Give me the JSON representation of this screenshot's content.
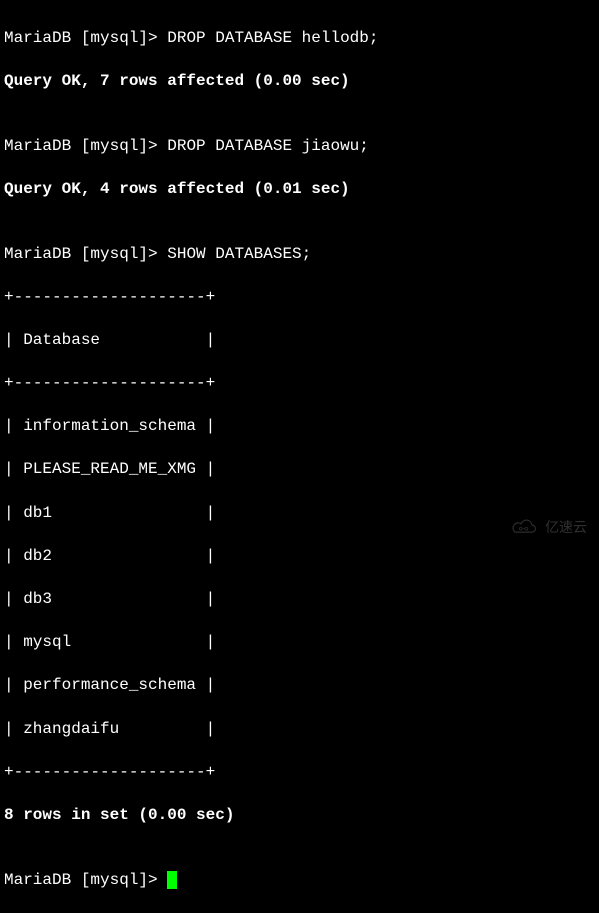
{
  "lines": {
    "l1_prompt": "MariaDB [mysql]> ",
    "l1_cmd": "DROP DATABASE hellodb;",
    "l2": "Query OK, 7 rows affected (0.00 sec)",
    "l3": "",
    "l4_prompt": "MariaDB [mysql]> ",
    "l4_cmd": "DROP DATABASE jiaowu;",
    "l5": "Query OK, 4 rows affected (0.01 sec)",
    "l6": "",
    "l7_prompt": "MariaDB [mysql]> ",
    "l7_cmd": "SHOW DATABASES;",
    "l8": "+--------------------+",
    "l9": "| Database           |",
    "l10": "+--------------------+",
    "l11": "| information_schema |",
    "l12": "| PLEASE_READ_ME_XMG |",
    "l13": "| db1                |",
    "l14": "| db2                |",
    "l15": "| db3                |",
    "l16": "| mysql              |",
    "l17": "| performance_schema |",
    "l18": "| zhangdaifu         |",
    "l19": "+--------------------+",
    "l20": "8 rows in set (0.00 sec)",
    "l21": "",
    "l22_prompt": "MariaDB [mysql]> "
  },
  "watermark": {
    "text": "亿速云"
  },
  "chart_data": {
    "type": "table",
    "title": "SHOW DATABASES",
    "columns": [
      "Database"
    ],
    "rows": [
      [
        "information_schema"
      ],
      [
        "PLEASE_READ_ME_XMG"
      ],
      [
        "db1"
      ],
      [
        "db2"
      ],
      [
        "db3"
      ],
      [
        "mysql"
      ],
      [
        "performance_schema"
      ],
      [
        "zhangdaifu"
      ]
    ],
    "row_count_summary": "8 rows in set (0.00 sec)",
    "preceding_queries": [
      {
        "sql": "DROP DATABASE hellodb;",
        "result": "Query OK, 7 rows affected (0.00 sec)"
      },
      {
        "sql": "DROP DATABASE jiaowu;",
        "result": "Query OK, 4 rows affected (0.01 sec)"
      }
    ]
  }
}
